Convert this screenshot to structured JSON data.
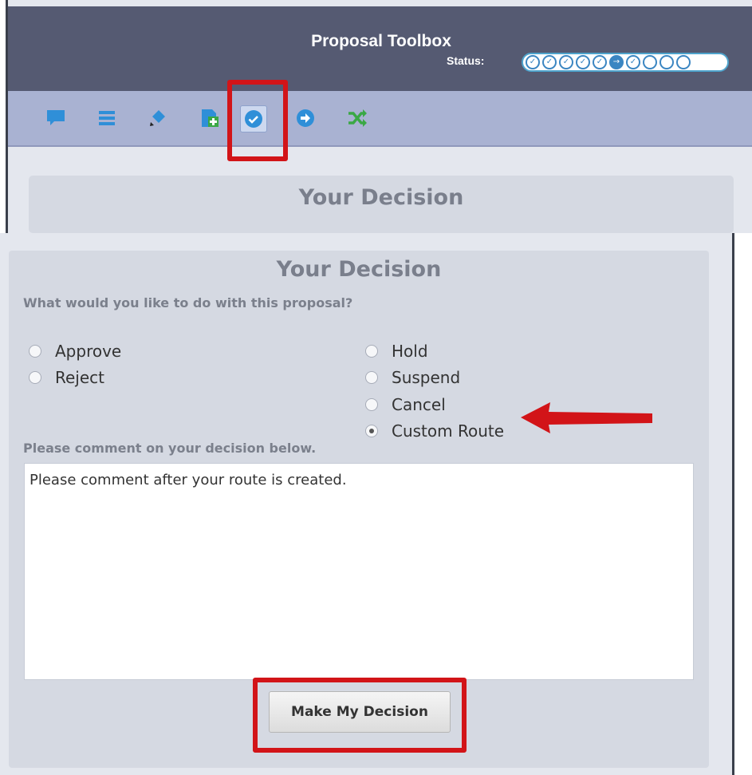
{
  "header": {
    "title": "Proposal Toolbox",
    "status_label": "Status:",
    "status_steps": [
      "done",
      "done",
      "done",
      "done",
      "done",
      "current",
      "done",
      "pending",
      "pending",
      "pending"
    ]
  },
  "toolbar": {
    "icons": [
      "comment-icon",
      "list-icon",
      "edit-icon",
      "add-document-icon",
      "checkmark-icon",
      "arrow-right-icon",
      "shuffle-icon"
    ],
    "active": "checkmark-icon"
  },
  "panel": {
    "title": "Your Decision"
  },
  "form": {
    "title": "Your Decision",
    "question": "What would you like to do with this proposal?",
    "options_left": [
      "Approve",
      "Reject"
    ],
    "options_right": [
      "Hold",
      "Suspend",
      "Cancel",
      "Custom Route"
    ],
    "selected": "Custom Route",
    "comment_label": "Please comment on your decision below.",
    "comment_value": "Please comment after your route is created.",
    "submit_label": "Make My Decision"
  },
  "colors": {
    "header_bg": "#555a72",
    "toolbar_bg": "#a9b2d2",
    "highlight_red": "#d21418",
    "icon_blue": "#2f8fd8",
    "icon_green": "#3aa845"
  }
}
